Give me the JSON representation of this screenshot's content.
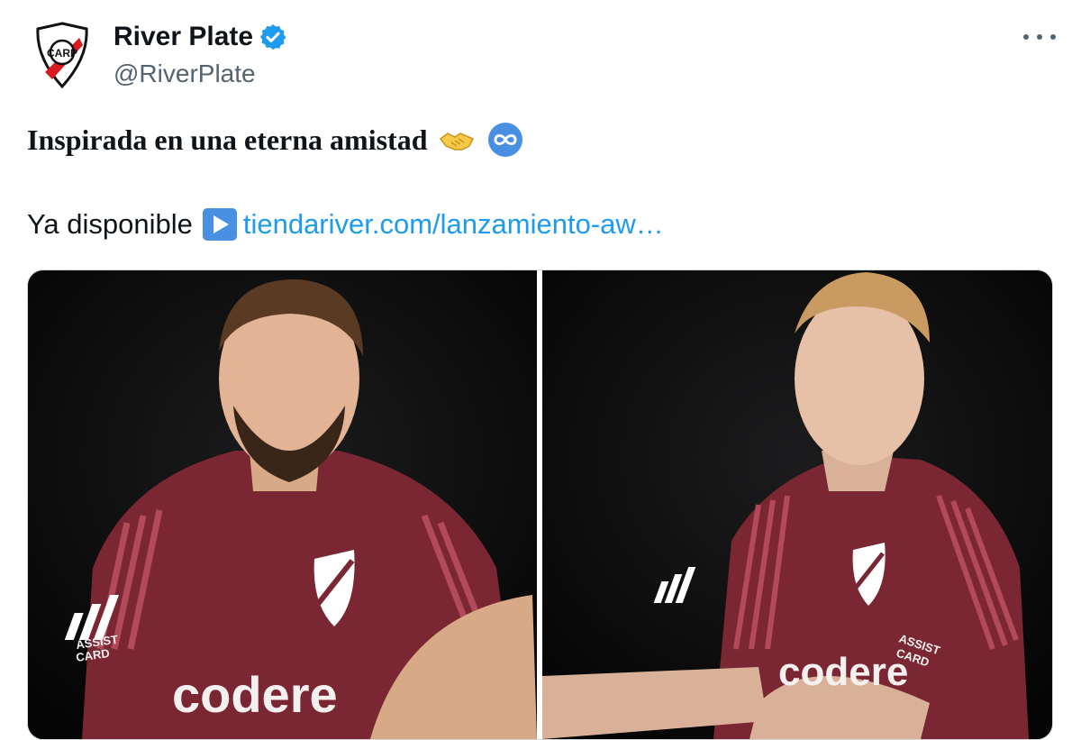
{
  "tweet": {
    "author": {
      "display_name": "River Plate",
      "handle": "@RiverPlate",
      "verified": true,
      "avatar_icon": "river-plate-crest-icon",
      "verified_color": "#1d9bf0"
    },
    "more_icon": "more-dots-icon",
    "headline": "Inspirada en una eterna amistad",
    "headline_emojis": [
      "handshake-emoji",
      "infinity-emoji"
    ],
    "body_prefix": "Ya disponible",
    "body_icon": "play-button-emoji",
    "link_text": "tiendariver.com/lanzamiento-aw…",
    "link_color": "#1d9bf0",
    "media": {
      "count": 2,
      "items": [
        {
          "name": "player-photo-left",
          "sponsor": "codere",
          "sleeve": "ASSIST CARD"
        },
        {
          "name": "player-photo-right",
          "sponsor": "codere",
          "sleeve": "ASSIST CARD"
        }
      ],
      "jersey_color": "#7b2733"
    }
  }
}
